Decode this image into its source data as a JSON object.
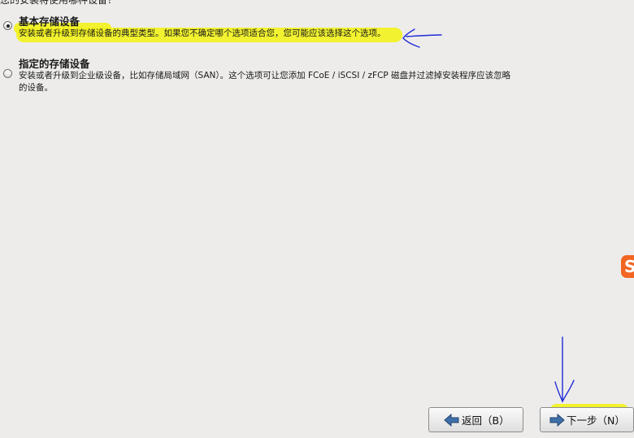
{
  "header": {
    "cut_text": "您的安装将使用哪种设备？"
  },
  "options": [
    {
      "title": "基本存储设备",
      "description": "安装或者升级到存储设备的典型类型。如果您不确定哪个选项适合您，您可能应该选择这个选项。",
      "selected": true
    },
    {
      "title": "指定的存储设备",
      "description": "安装或者升级到企业级设备，比如存储局域网（SAN）。这个选项可让您添加 FCoE / iSCSI / zFCP 磁盘并过滤掉安装程序应该忽略的设备。",
      "selected": false
    }
  ],
  "buttons": {
    "back": "返回（B）",
    "next": "下一步（N）"
  },
  "side_logo": {
    "text": "S",
    "color": "#f26522"
  },
  "annotations": {
    "highlight_color": "#f2f21f",
    "pen_color": "#1f2bd6"
  }
}
